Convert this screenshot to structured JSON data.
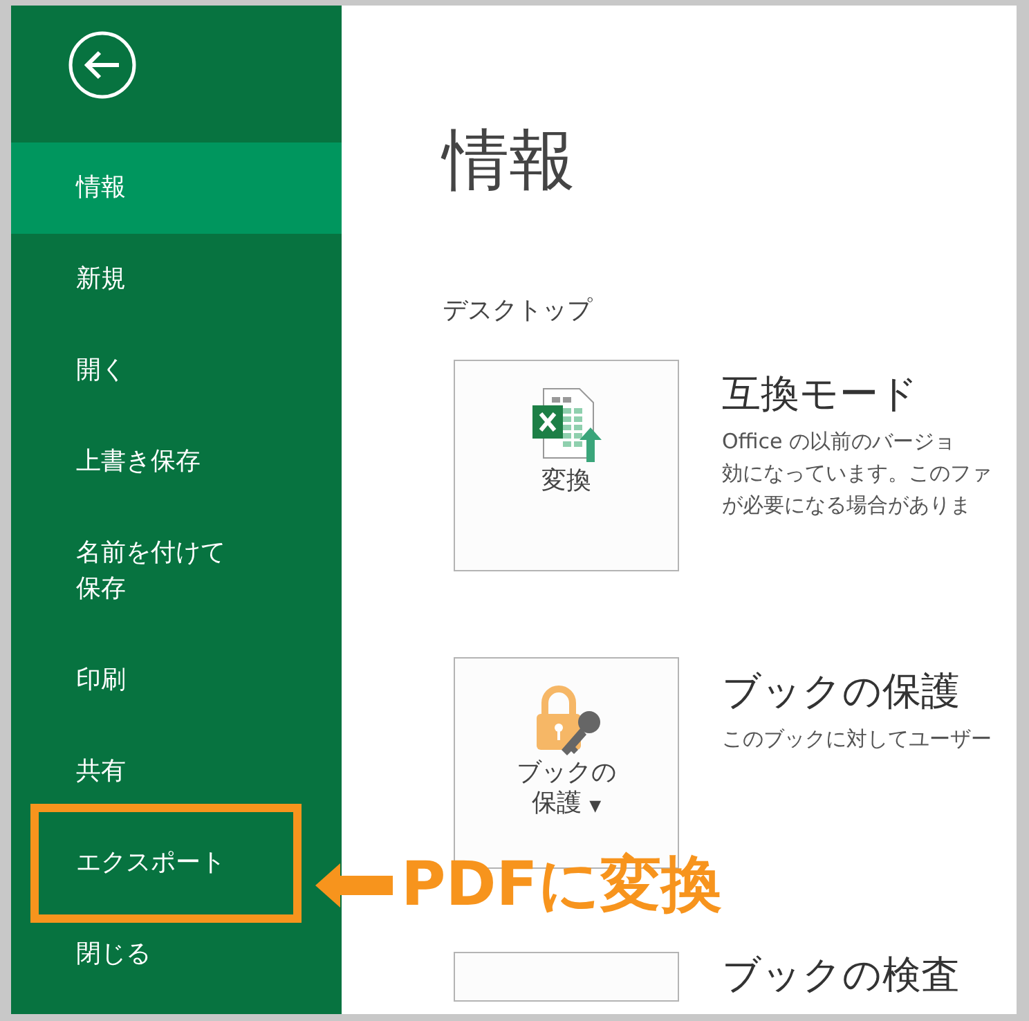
{
  "sidebar": {
    "items": [
      {
        "label": "情報",
        "selected": true,
        "highlighted": false
      },
      {
        "label": "新規",
        "selected": false,
        "highlighted": false
      },
      {
        "label": "開く",
        "selected": false,
        "highlighted": false
      },
      {
        "label": "上書き保存",
        "selected": false,
        "highlighted": false
      },
      {
        "label": "名前を付けて保存",
        "selected": false,
        "highlighted": false
      },
      {
        "label": "印刷",
        "selected": false,
        "highlighted": false
      },
      {
        "label": "共有",
        "selected": false,
        "highlighted": false
      },
      {
        "label": "エクスポート",
        "selected": false,
        "highlighted": true
      },
      {
        "label": "閉じる",
        "selected": false,
        "highlighted": false
      }
    ]
  },
  "page_title": "情報",
  "section_label": "デスクトップ",
  "cards": [
    {
      "kind": "convert",
      "button_lines": [
        "変換"
      ],
      "title": "互換モード",
      "description_lines": [
        "Office の以前のバージョ",
        "効になっています。このファ",
        "が必要になる場合がありま"
      ]
    },
    {
      "kind": "protect",
      "button_lines": [
        "ブックの",
        "保護"
      ],
      "dropdown_caret": "▼",
      "title": "ブックの保護",
      "description_lines": [
        "このブックに対してユーザー"
      ]
    },
    {
      "kind": "inspect",
      "title": "ブックの検査"
    }
  ],
  "callout": {
    "label": "PDFに変換"
  }
}
